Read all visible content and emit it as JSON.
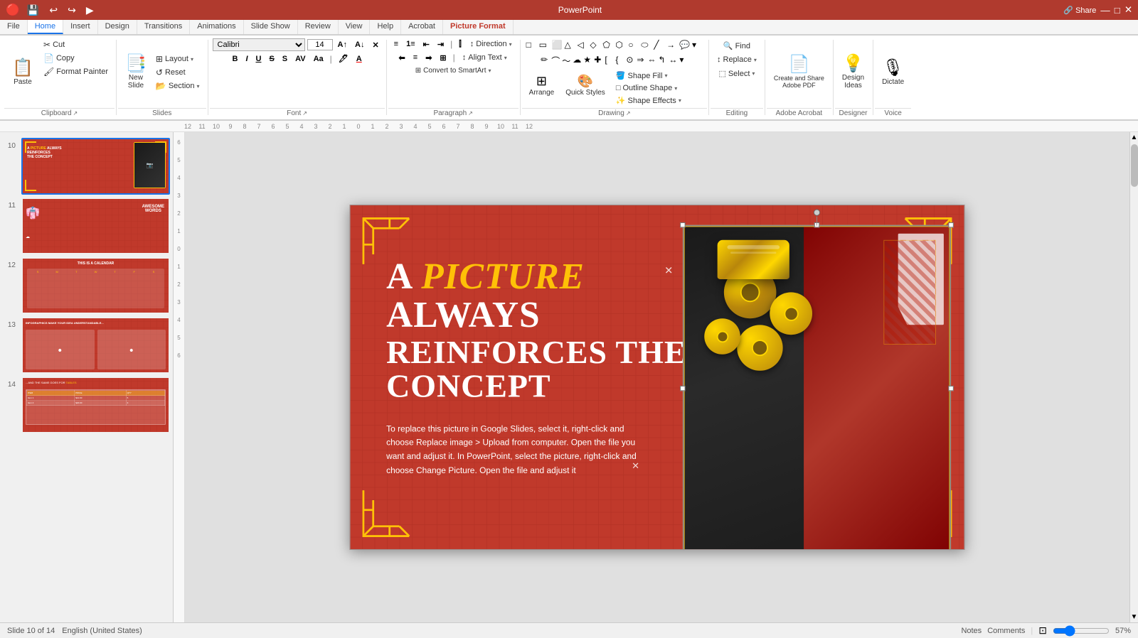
{
  "app": {
    "title": "PowerPoint",
    "share_label": "Share"
  },
  "menu": {
    "items": [
      "File",
      "Home",
      "Insert",
      "Design",
      "Transitions",
      "Animations",
      "Slide Show",
      "Review",
      "View",
      "Help",
      "Acrobat",
      "Picture Format"
    ]
  },
  "quick_access": {
    "save_icon": "💾",
    "undo_icon": "↩",
    "redo_icon": "↪",
    "present_icon": "▶"
  },
  "ribbon": {
    "clipboard": {
      "label": "Clipboard",
      "paste_label": "Paste",
      "cut_label": "Cut",
      "copy_label": "Copy",
      "format_painter_label": "Format Painter"
    },
    "slides": {
      "label": "Slides",
      "new_slide_label": "New\nSlide",
      "layout_label": "Layout",
      "reset_label": "Reset",
      "section_label": "Section"
    },
    "font": {
      "label": "Font",
      "family": "Calibri",
      "size": "14",
      "bold": "B",
      "italic": "I",
      "underline": "U",
      "strikethrough": "S",
      "shadow": "S",
      "case_label": "Aa",
      "font_color_label": "A",
      "char_spacing_label": "AV",
      "increase_size": "A↑",
      "decrease_size": "A↓",
      "clear_format": "A✕"
    },
    "paragraph": {
      "label": "Paragraph",
      "bullets_label": "≡",
      "numbers_label": "1≡",
      "indent_left": "⇤",
      "indent_right": "⇥",
      "direction_label": "Direction",
      "align_text_label": "Align Text",
      "convert_smartart": "Convert to SmartArt"
    },
    "drawing": {
      "label": "Drawing",
      "arrange_label": "Arrange",
      "quick_styles_label": "Quick\nStyles",
      "shape_fill_label": "Shape Fill",
      "shape_outline_label": "Shape Outline",
      "shape_effects_label": "Shape Effects"
    },
    "editing": {
      "label": "Editing",
      "find_label": "Find",
      "replace_label": "Replace",
      "select_label": "Select"
    },
    "adobe": {
      "label": "Adobe Acrobat",
      "create_share_label": "Create and Share\nAdobe PDF"
    },
    "designer": {
      "label": "Designer",
      "design_ideas_label": "Design\nIdeas"
    },
    "voice": {
      "label": "Voice",
      "dictate_label": "Dictate"
    }
  },
  "slides": [
    {
      "num": "10",
      "active": true,
      "bg_color": "#c0392b",
      "label": "Picture Always Reinforces slide"
    },
    {
      "num": "11",
      "active": false,
      "bg_color": "#c0392b",
      "label": "Awesome Words slide"
    },
    {
      "num": "12",
      "active": false,
      "bg_color": "#c0392b",
      "label": "Calendar slide"
    },
    {
      "num": "13",
      "active": false,
      "bg_color": "#c0392b",
      "label": "Infographics slide"
    },
    {
      "num": "14",
      "active": false,
      "bg_color": "#c0392b",
      "label": "Table slide"
    }
  ],
  "slide_content": {
    "title_line1_word1": "A",
    "title_line1_word2": "PICTURE",
    "title_line1_word3": "ALWAYS",
    "title_line2": "REINFORCES THE CONCEPT",
    "body_text": "To replace this picture in Google Slides, select it, right-click and choose Replace image > Upload from computer. Open the file you want and adjust it. In PowerPoint, select the picture, right-click and choose Change Picture. Open the file and adjust it",
    "image_alt": "Chinese New Year gold coins and decorative items on dark background"
  },
  "status_bar": {
    "slide_info": "Slide 10 of 14",
    "language": "English (United States)",
    "notes": "Notes",
    "comments": "Comments",
    "zoom_level": "57%",
    "fit_label": "⊡"
  },
  "colors": {
    "accent_red": "#c0392b",
    "accent_gold": "#ffc107",
    "white": "#ffffff",
    "ribbon_bg": "#ffffff",
    "active_tab_underline": "#c0392b"
  }
}
